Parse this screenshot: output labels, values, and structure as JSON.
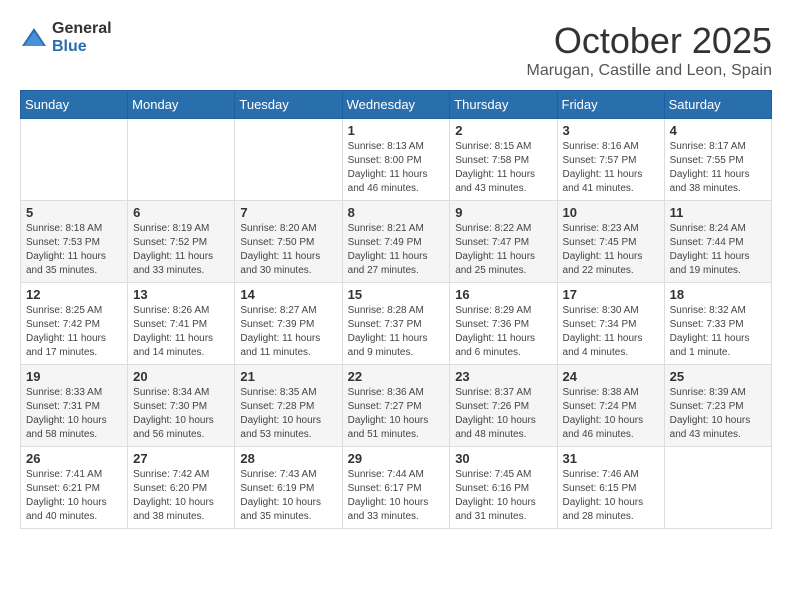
{
  "logo": {
    "general": "General",
    "blue": "Blue"
  },
  "header": {
    "month": "October 2025",
    "location": "Marugan, Castille and Leon, Spain"
  },
  "days_of_week": [
    "Sunday",
    "Monday",
    "Tuesday",
    "Wednesday",
    "Thursday",
    "Friday",
    "Saturday"
  ],
  "weeks": [
    [
      {
        "day": "",
        "info": ""
      },
      {
        "day": "",
        "info": ""
      },
      {
        "day": "",
        "info": ""
      },
      {
        "day": "1",
        "info": "Sunrise: 8:13 AM\nSunset: 8:00 PM\nDaylight: 11 hours and 46 minutes."
      },
      {
        "day": "2",
        "info": "Sunrise: 8:15 AM\nSunset: 7:58 PM\nDaylight: 11 hours and 43 minutes."
      },
      {
        "day": "3",
        "info": "Sunrise: 8:16 AM\nSunset: 7:57 PM\nDaylight: 11 hours and 41 minutes."
      },
      {
        "day": "4",
        "info": "Sunrise: 8:17 AM\nSunset: 7:55 PM\nDaylight: 11 hours and 38 minutes."
      }
    ],
    [
      {
        "day": "5",
        "info": "Sunrise: 8:18 AM\nSunset: 7:53 PM\nDaylight: 11 hours and 35 minutes."
      },
      {
        "day": "6",
        "info": "Sunrise: 8:19 AM\nSunset: 7:52 PM\nDaylight: 11 hours and 33 minutes."
      },
      {
        "day": "7",
        "info": "Sunrise: 8:20 AM\nSunset: 7:50 PM\nDaylight: 11 hours and 30 minutes."
      },
      {
        "day": "8",
        "info": "Sunrise: 8:21 AM\nSunset: 7:49 PM\nDaylight: 11 hours and 27 minutes."
      },
      {
        "day": "9",
        "info": "Sunrise: 8:22 AM\nSunset: 7:47 PM\nDaylight: 11 hours and 25 minutes."
      },
      {
        "day": "10",
        "info": "Sunrise: 8:23 AM\nSunset: 7:45 PM\nDaylight: 11 hours and 22 minutes."
      },
      {
        "day": "11",
        "info": "Sunrise: 8:24 AM\nSunset: 7:44 PM\nDaylight: 11 hours and 19 minutes."
      }
    ],
    [
      {
        "day": "12",
        "info": "Sunrise: 8:25 AM\nSunset: 7:42 PM\nDaylight: 11 hours and 17 minutes."
      },
      {
        "day": "13",
        "info": "Sunrise: 8:26 AM\nSunset: 7:41 PM\nDaylight: 11 hours and 14 minutes."
      },
      {
        "day": "14",
        "info": "Sunrise: 8:27 AM\nSunset: 7:39 PM\nDaylight: 11 hours and 11 minutes."
      },
      {
        "day": "15",
        "info": "Sunrise: 8:28 AM\nSunset: 7:37 PM\nDaylight: 11 hours and 9 minutes."
      },
      {
        "day": "16",
        "info": "Sunrise: 8:29 AM\nSunset: 7:36 PM\nDaylight: 11 hours and 6 minutes."
      },
      {
        "day": "17",
        "info": "Sunrise: 8:30 AM\nSunset: 7:34 PM\nDaylight: 11 hours and 4 minutes."
      },
      {
        "day": "18",
        "info": "Sunrise: 8:32 AM\nSunset: 7:33 PM\nDaylight: 11 hours and 1 minute."
      }
    ],
    [
      {
        "day": "19",
        "info": "Sunrise: 8:33 AM\nSunset: 7:31 PM\nDaylight: 10 hours and 58 minutes."
      },
      {
        "day": "20",
        "info": "Sunrise: 8:34 AM\nSunset: 7:30 PM\nDaylight: 10 hours and 56 minutes."
      },
      {
        "day": "21",
        "info": "Sunrise: 8:35 AM\nSunset: 7:28 PM\nDaylight: 10 hours and 53 minutes."
      },
      {
        "day": "22",
        "info": "Sunrise: 8:36 AM\nSunset: 7:27 PM\nDaylight: 10 hours and 51 minutes."
      },
      {
        "day": "23",
        "info": "Sunrise: 8:37 AM\nSunset: 7:26 PM\nDaylight: 10 hours and 48 minutes."
      },
      {
        "day": "24",
        "info": "Sunrise: 8:38 AM\nSunset: 7:24 PM\nDaylight: 10 hours and 46 minutes."
      },
      {
        "day": "25",
        "info": "Sunrise: 8:39 AM\nSunset: 7:23 PM\nDaylight: 10 hours and 43 minutes."
      }
    ],
    [
      {
        "day": "26",
        "info": "Sunrise: 7:41 AM\nSunset: 6:21 PM\nDaylight: 10 hours and 40 minutes."
      },
      {
        "day": "27",
        "info": "Sunrise: 7:42 AM\nSunset: 6:20 PM\nDaylight: 10 hours and 38 minutes."
      },
      {
        "day": "28",
        "info": "Sunrise: 7:43 AM\nSunset: 6:19 PM\nDaylight: 10 hours and 35 minutes."
      },
      {
        "day": "29",
        "info": "Sunrise: 7:44 AM\nSunset: 6:17 PM\nDaylight: 10 hours and 33 minutes."
      },
      {
        "day": "30",
        "info": "Sunrise: 7:45 AM\nSunset: 6:16 PM\nDaylight: 10 hours and 31 minutes."
      },
      {
        "day": "31",
        "info": "Sunrise: 7:46 AM\nSunset: 6:15 PM\nDaylight: 10 hours and 28 minutes."
      },
      {
        "day": "",
        "info": ""
      }
    ]
  ]
}
